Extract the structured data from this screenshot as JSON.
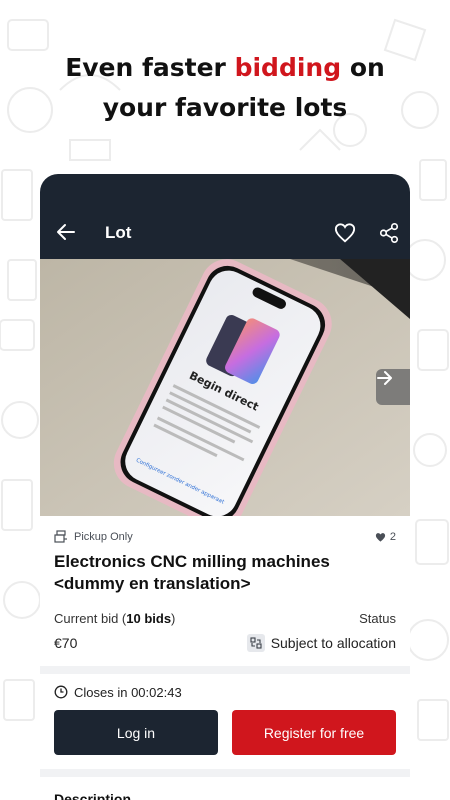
{
  "headline": {
    "part1": "Even faster ",
    "accent": "bidding",
    "part2": " on",
    "line2": "your favorite lots"
  },
  "appbar": {
    "title": "Lot",
    "icons": [
      "arrow-left-icon",
      "heart-outline-icon",
      "share-icon"
    ]
  },
  "photo": {
    "screen_heading": "Begin direct",
    "screen_link": "Configureer zonder ander apparaat"
  },
  "lot": {
    "pickup_label": "Pickup Only",
    "likes": "2",
    "title_line1": "Electronics CNC milling machines",
    "title_line2": "<dummy en translation>",
    "current_bid_label": "Current bid (",
    "bids_count": "10 bids",
    "current_bid_close": ")",
    "status_label": "Status",
    "price": "€70",
    "status_value": "Subject to allocation"
  },
  "auction": {
    "closes_text": "Closes in 00:02:43"
  },
  "buttons": {
    "login": "Log in",
    "register": "Register for free"
  },
  "description_heading": "Description",
  "colors": {
    "accent": "#d0161d",
    "navy": "#1c2531"
  }
}
